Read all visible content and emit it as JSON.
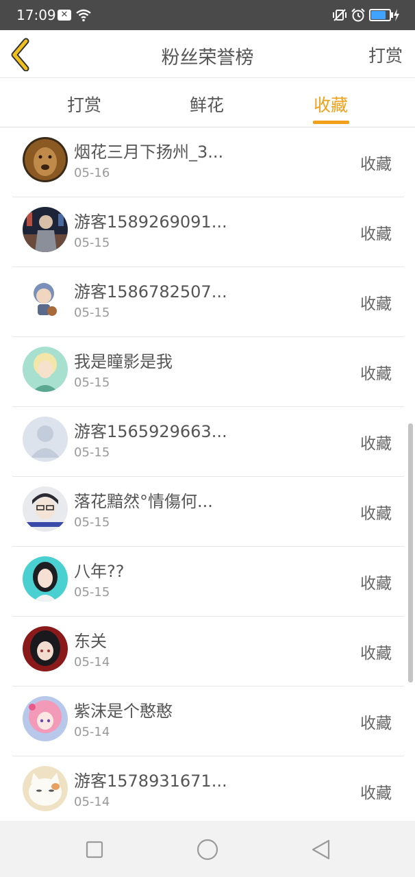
{
  "status_bar": {
    "time": "17:09",
    "icons": [
      "notification-x-icon",
      "wifi-icon",
      "vibrate-icon",
      "alarm-icon",
      "battery-icon",
      "charging-bolt-icon"
    ],
    "battery_level": 0.82,
    "battery_color": "#3fa3ff"
  },
  "header": {
    "title": "粉丝荣誉榜",
    "action": "打赏",
    "back_icon": "chevron-left-icon",
    "back_icon_color": "#f0c020"
  },
  "tabs": [
    {
      "label": "打赏",
      "active": false
    },
    {
      "label": "鲜花",
      "active": false
    },
    {
      "label": "收藏",
      "active": true
    }
  ],
  "accent_color": "#f0a01a",
  "list": {
    "rows": [
      {
        "name": "烟花三月下扬州_3...",
        "date": "05-16",
        "action": "收藏",
        "avatar": "lion-avatar"
      },
      {
        "name": "游客1589269091...",
        "date": "05-15",
        "action": "收藏",
        "avatar": "anime-figure-avatar"
      },
      {
        "name": "游客1586782507...",
        "date": "05-15",
        "action": "收藏",
        "avatar": "chibi-boy-avatar"
      },
      {
        "name": "我是瞳影是我",
        "date": "05-15",
        "action": "收藏",
        "avatar": "anime-boy-avatar"
      },
      {
        "name": "游客1565929663...",
        "date": "05-15",
        "action": "收藏",
        "avatar": "default-user-avatar"
      },
      {
        "name": "落花黯然°情傷何...",
        "date": "05-15",
        "action": "收藏",
        "avatar": "glasses-boy-avatar"
      },
      {
        "name": "八年??",
        "date": "05-15",
        "action": "收藏",
        "avatar": "girl-portrait-avatar"
      },
      {
        "name": "东关",
        "date": "05-14",
        "action": "收藏",
        "avatar": "dark-hair-girl-avatar"
      },
      {
        "name": "紫沫是个憨憨",
        "date": "05-14",
        "action": "收藏",
        "avatar": "pink-anime-girl-avatar"
      },
      {
        "name": "游客1578931671...",
        "date": "05-14",
        "action": "收藏",
        "avatar": "cat-avatar"
      }
    ]
  },
  "nav_bar": {
    "buttons": [
      "recents-square-icon",
      "home-circle-icon",
      "back-triangle-icon"
    ]
  }
}
